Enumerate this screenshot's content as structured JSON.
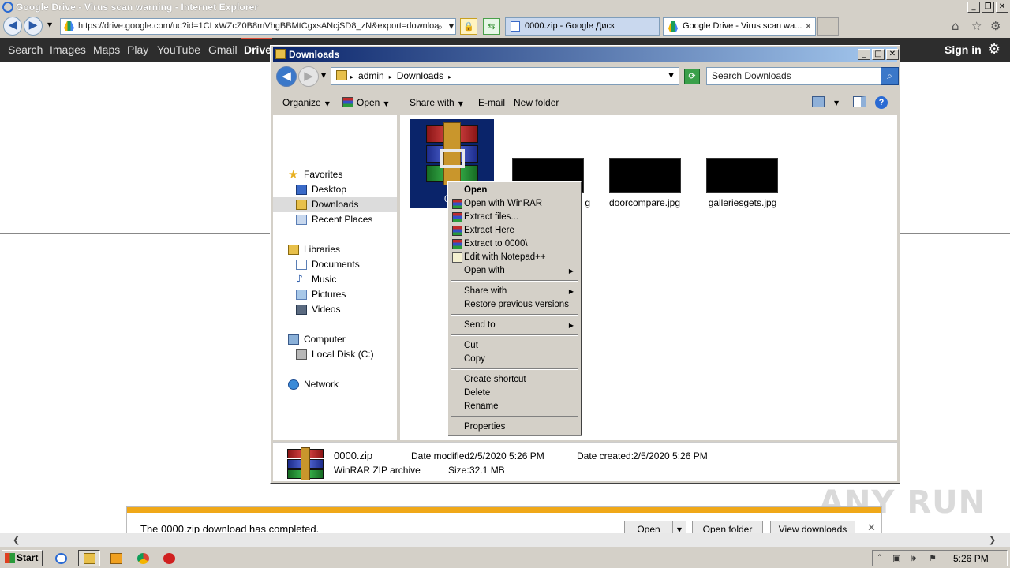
{
  "ie": {
    "title": "Google Drive - Virus scan warning - Internet Explorer",
    "url": "https://drive.google.com/uc?id=1CLxWZcZ0B8mVhgBBMtCgxsANcjSD8_zN&export=downloa",
    "tabs": [
      {
        "label": "0000.zip - Google Диск"
      },
      {
        "label": "Google Drive - Virus scan wa..."
      }
    ]
  },
  "google_bar": {
    "links": [
      "Search",
      "Images",
      "Maps",
      "Play",
      "YouTube",
      "Gmail",
      "Drive"
    ],
    "sign_in": "Sign in"
  },
  "explorer": {
    "title": "Downloads",
    "path": [
      "admin",
      "Downloads"
    ],
    "search_placeholder": "Search Downloads",
    "commands": {
      "organize": "Organize",
      "open": "Open",
      "share_with": "Share with",
      "email": "E-mail",
      "new_folder": "New folder"
    },
    "nav": {
      "favorites": "Favorites",
      "desktop": "Desktop",
      "downloads": "Downloads",
      "recent": "Recent Places",
      "libraries": "Libraries",
      "documents": "Documents",
      "music": "Music",
      "pictures": "Pictures",
      "videos": "Videos",
      "computer": "Computer",
      "local_disk": "Local Disk (C:)",
      "network": "Network"
    },
    "files": {
      "zip_partial": "000",
      "file2_partial": "g",
      "file3": "doorcompare.jpg",
      "file4": "galleriesgets.jpg"
    },
    "details": {
      "name": "0000.zip",
      "type": "WinRAR ZIP archive",
      "modified_label": "Date modified:",
      "modified_value": "2/5/2020 5:26 PM",
      "created_label": "Date created:",
      "created_value": "2/5/2020 5:26 PM",
      "size_label": "Size:",
      "size_value": "32.1 MB"
    }
  },
  "context_menu": {
    "open": "Open",
    "open_winrar": "Open with WinRAR",
    "extract_files": "Extract files...",
    "extract_here": "Extract Here",
    "extract_to": "Extract to 0000\\",
    "edit_npp": "Edit with Notepad++",
    "open_with": "Open with",
    "share_with": "Share with",
    "restore": "Restore previous versions",
    "send_to": "Send to",
    "cut": "Cut",
    "copy": "Copy",
    "create_shortcut": "Create shortcut",
    "delete": "Delete",
    "rename": "Rename",
    "properties": "Properties"
  },
  "download": {
    "message": "The 0000.zip download has completed.",
    "open": "Open",
    "open_folder": "Open folder",
    "view_downloads": "View downloads"
  },
  "watermark": "ANY RUN",
  "taskbar": {
    "start": "Start",
    "clock": "5:26 PM"
  },
  "icons": {
    "close": "close-icon",
    "gear": "gear-icon",
    "search": "search-icon",
    "winrar": "winrar-icon"
  }
}
